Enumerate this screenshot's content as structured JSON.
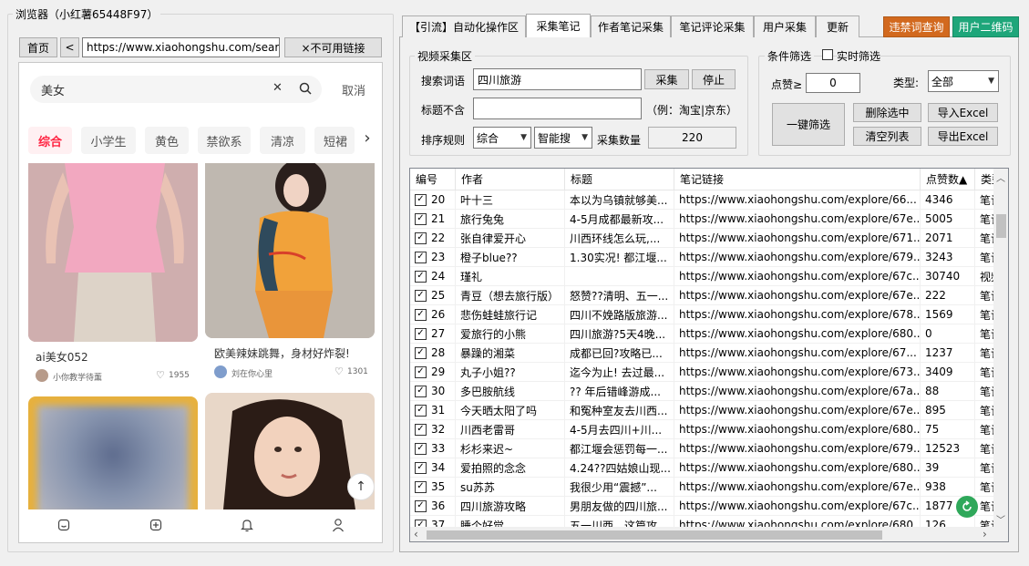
{
  "browser": {
    "group_title": "浏览器（小红薯65448F97）",
    "home_btn": "首页",
    "back_btn": "<",
    "url": "https://www.xiaohongshu.com/search",
    "disable_btn": "×不可用链接",
    "search_text": "美女",
    "clear_icon": "✕",
    "cancel": "取消",
    "chips": [
      "综合",
      "小学生",
      "黄色",
      "禁欲系",
      "清凉",
      "短裙"
    ],
    "cards": [
      {
        "title": "ai美女052",
        "author": "小你教学待薰",
        "likes": "1955"
      },
      {
        "title": "欧美辣妹跳舞，身材好炸裂!",
        "author": "刘在你心里",
        "likes": "1301"
      }
    ]
  },
  "tabs": [
    "【引流】自动化操作区",
    "采集笔记",
    "作者笔记采集",
    "笔记评论采集",
    "用户采集",
    "更新"
  ],
  "top_buttons": {
    "forbidden": "违禁词查询",
    "qrcode": "用户二维码"
  },
  "collect": {
    "group_title": "视频采集区",
    "keyword_label": "搜索词语",
    "keyword_value": "四川旅游",
    "collect_btn": "采集",
    "stop_btn": "停止",
    "exclude_label": "标题不含",
    "exclude_value": "",
    "exclude_hint": "（例：淘宝|京东）",
    "sort_label": "排序规则",
    "sort_value": "综合",
    "smart_value": "智能搜",
    "count_label": "采集数量",
    "count_value": "220"
  },
  "filter": {
    "group_title": "条件筛选",
    "realtime_label": "实时筛选",
    "likes_label": "点赞≥",
    "likes_value": "0",
    "type_label": "类型:",
    "type_value": "全部",
    "one_click_btn": "一键筛选",
    "delete_btn": "删除选中",
    "import_btn": "导入Excel",
    "clear_btn": "清空列表",
    "export_btn": "导出Excel"
  },
  "table": {
    "headers": [
      "编号",
      "作者",
      "标题",
      "笔记链接",
      "点赞数▲",
      "类型"
    ],
    "rows": [
      [
        "20",
        "叶十三",
        "本以为乌镇就够美...",
        "https://www.xiaohongshu.com/explore/66...",
        "4346",
        "笔记"
      ],
      [
        "21",
        "旅行兔兔",
        "4-5月成都最新攻...",
        "https://www.xiaohongshu.com/explore/67e...",
        "5005",
        "笔记"
      ],
      [
        "22",
        "张自律爱开心",
        "川西环线怎么玩,...",
        "https://www.xiaohongshu.com/explore/671...",
        "2071",
        "笔记"
      ],
      [
        "23",
        "橙子blue??",
        "1.30实况! 都江堰...",
        "https://www.xiaohongshu.com/explore/679...",
        "3243",
        "笔记"
      ],
      [
        "24",
        "瑾礼",
        "",
        "https://www.xiaohongshu.com/explore/67c...",
        "30740",
        "视频"
      ],
      [
        "25",
        "青豆（想去旅行版）",
        "怒赞??清明、五一...",
        "https://www.xiaohongshu.com/explore/67e...",
        "222",
        "笔记"
      ],
      [
        "26",
        "悲伤蛙蛙旅行记",
        "四川不娩路版旅游...",
        "https://www.xiaohongshu.com/explore/678...",
        "1569",
        "笔记"
      ],
      [
        "27",
        "爱旅行的小熊",
        "四川旅游?5天4晚...",
        "https://www.xiaohongshu.com/explore/680...",
        "0",
        "笔记"
      ],
      [
        "28",
        "暴躁的湘菜",
        "成都已回?攻略已...",
        "https://www.xiaohongshu.com/explore/67...",
        "1237",
        "笔记"
      ],
      [
        "29",
        "丸子小姐??",
        "迄今为止! 去过最...",
        "https://www.xiaohongshu.com/explore/673...",
        "3409",
        "笔记"
      ],
      [
        "30",
        "多巴胺航线",
        "?? 年后错峰游成...",
        "https://www.xiaohongshu.com/explore/67a...",
        "88",
        "笔记"
      ],
      [
        "31",
        "今天晒太阳了吗",
        "和冤种室友去川西...",
        "https://www.xiaohongshu.com/explore/67e...",
        "895",
        "笔记"
      ],
      [
        "32",
        "川西老雷哥",
        "4-5月去四川+川...",
        "https://www.xiaohongshu.com/explore/680...",
        "75",
        "笔记"
      ],
      [
        "33",
        "杉杉来迟~",
        "都江堰会惩罚每一...",
        "https://www.xiaohongshu.com/explore/679...",
        "12523",
        "笔记"
      ],
      [
        "34",
        "爱拍照的念念",
        "4.24??四姑娘山现...",
        "https://www.xiaohongshu.com/explore/680...",
        "39",
        "笔记"
      ],
      [
        "35",
        "su苏苏",
        "我很少用“震撼”...",
        "https://www.xiaohongshu.com/explore/67e...",
        "938",
        "笔记"
      ],
      [
        "36",
        "四川旅游攻略",
        "男朋友做的四川旅...",
        "https://www.xiaohongshu.com/explore/67c...",
        "1877",
        "笔记"
      ],
      [
        "37",
        "睡个好觉",
        "五一川西，这篇攻...",
        "https://www.xiaohongshu.com/explore/680...",
        "126",
        "笔记"
      ]
    ]
  },
  "colors": {
    "forbidden_bg": "#d2691e",
    "qrcode_bg": "#1ea67a",
    "chip_active": "#ff2442"
  }
}
